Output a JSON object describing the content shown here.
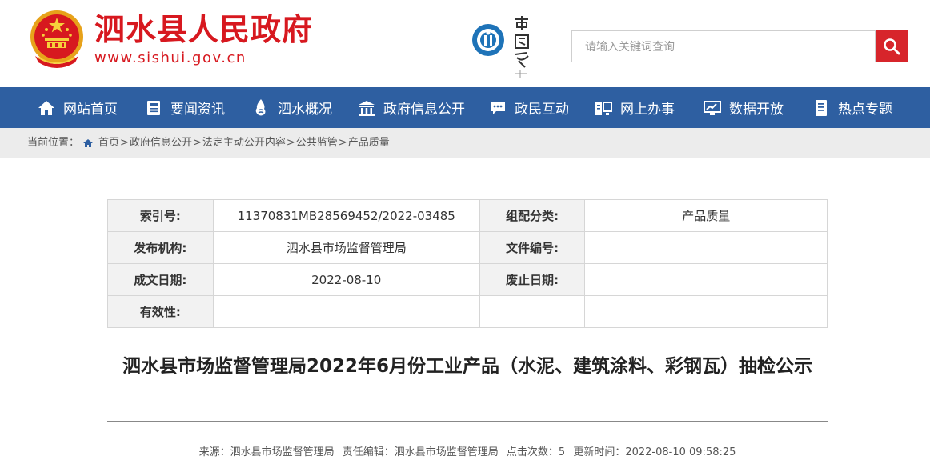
{
  "header": {
    "site_title": "泗水县人民政府",
    "site_url": "www.sishui.gov.cn",
    "search_placeholder": "请输入关键词查询",
    "brand_red": "#d7181f"
  },
  "nav": {
    "items": [
      {
        "label": "网站首页",
        "icon": "home-icon"
      },
      {
        "label": "要闻资讯",
        "icon": "newspaper-icon"
      },
      {
        "label": "泗水概况",
        "icon": "water-icon"
      },
      {
        "label": "政府信息公开",
        "icon": "government-icon"
      },
      {
        "label": "政民互动",
        "icon": "chat-icon"
      },
      {
        "label": "网上办事",
        "icon": "office-icon"
      },
      {
        "label": "数据开放",
        "icon": "data-icon"
      },
      {
        "label": "热点专题",
        "icon": "document-icon"
      }
    ],
    "bg_color": "#2e5fa1"
  },
  "breadcrumb": {
    "prefix": "当前位置：",
    "items": [
      "首页",
      "政府信息公开",
      "法定主动公开内容",
      "公共监管",
      "产品质量"
    ]
  },
  "meta": {
    "index_label": "索引号:",
    "index_value": "11370831MB28569452/2022-03485",
    "category_label": "组配分类:",
    "category_value": "产品质量",
    "publisher_label": "发布机构:",
    "publisher_value": "泗水县市场监督管理局",
    "docno_label": "文件编号:",
    "docno_value": "",
    "date_label": "成文日期:",
    "date_value": "2022-08-10",
    "abolish_label": "废止日期:",
    "abolish_value": "",
    "validity_label": "有效性:",
    "validity_value": ""
  },
  "article": {
    "title": "泗水县市场监督管理局2022年6月份工业产品（水泥、建筑涂料、彩钢瓦）抽检公示",
    "source": "来源：泗水县市场监督管理局",
    "editor": "责任编辑：泗水县市场监督管理局",
    "clicks": "点击次数：5",
    "updated": "更新时间：2022-08-10 09:58:25"
  }
}
